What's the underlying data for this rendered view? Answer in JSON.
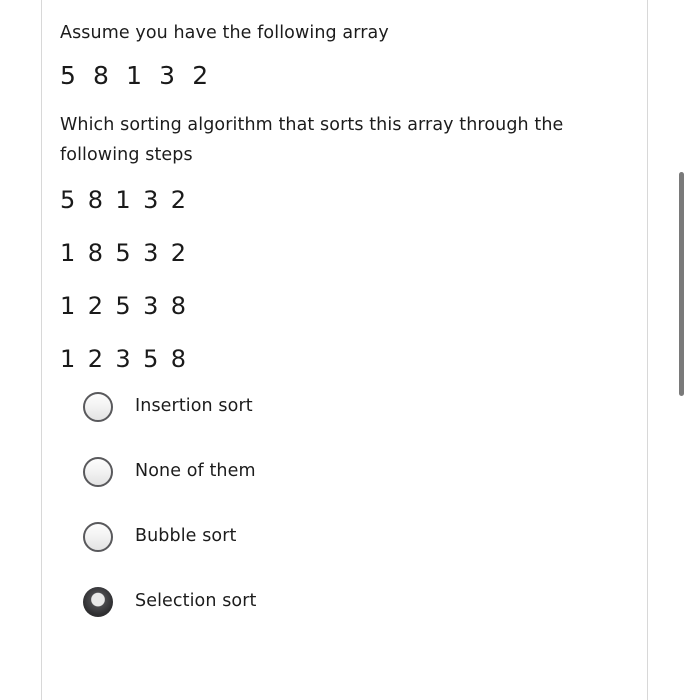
{
  "question": {
    "intro_text": "Assume you have the following array",
    "initial_array": "5 8 1 3 2",
    "question_text": "Which sorting algorithm that sorts this array through the following steps",
    "steps": [
      "5 8 1 3 2",
      "1 8 5 3 2",
      "1 2 5 3 8",
      "1 2 3 5 8"
    ],
    "options": [
      {
        "label": "Insertion sort",
        "selected": false
      },
      {
        "label": "None of them",
        "selected": false
      },
      {
        "label": "Bubble sort",
        "selected": false
      },
      {
        "label": "Selection sort",
        "selected": true
      }
    ]
  },
  "colors": {
    "text": "#1c1c1c",
    "border": "#d8d8d8",
    "radio_border": "#59595c",
    "radio_checked": "#3a3a3d",
    "scrollbar_thumb": "#7a7a7a",
    "background": "#ffffff"
  }
}
